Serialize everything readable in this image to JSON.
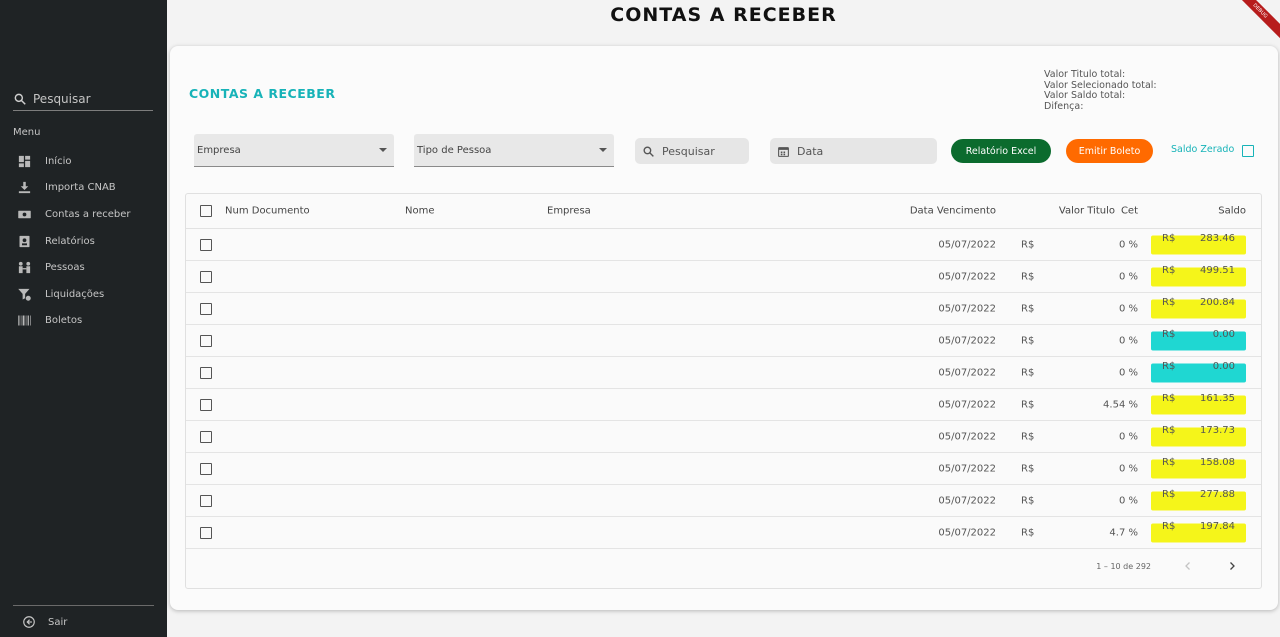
{
  "header": {
    "title": "CONTAS A RECEBER",
    "debug_label": "DEBUG"
  },
  "sidebar": {
    "search_placeholder": "Pesquisar",
    "menu_label": "Menu",
    "items": [
      {
        "label": "Início",
        "icon": "dashboard-icon"
      },
      {
        "label": "Importa CNAB",
        "icon": "download-icon"
      },
      {
        "label": "Contas a receber",
        "icon": "money-icon"
      },
      {
        "label": "Relatórios",
        "icon": "report-icon"
      },
      {
        "label": "Pessoas",
        "icon": "people-icon"
      },
      {
        "label": "Liquidações",
        "icon": "filter-money-icon"
      },
      {
        "label": "Boletos",
        "icon": "barcode-icon"
      }
    ],
    "logout_label": "Sair"
  },
  "card": {
    "title": "CONTAS A RECEBER",
    "totals": {
      "valor_titulo": "Valor Titulo total:",
      "valor_selecionado": "Valor Selecionado total:",
      "valor_saldo": "Valor Saldo total:",
      "diferenca": "Difença:"
    }
  },
  "filters": {
    "empresa": "Empresa",
    "tipo_pessoa": "Tipo de Pessoa",
    "search": "Pesquisar",
    "date": "Data",
    "excel_button": "Relatório Excel",
    "boleto_button": "Emitir Boleto",
    "saldo_zerado": "Saldo Zerado"
  },
  "table": {
    "columns": {
      "num_documento": "Num Documento",
      "nome": "Nome",
      "empresa": "Empresa",
      "data_vencimento": "Data Vencimento",
      "cet": "Cet",
      "valor_titulo": "Valor Titulo",
      "saldo": "Saldo"
    },
    "rows": [
      {
        "date": "05/07/2022",
        "cet": "0 %",
        "valor": "R$",
        "saldo_cur": "R$",
        "saldo": "283.46",
        "status": "yellow"
      },
      {
        "date": "05/07/2022",
        "cet": "0 %",
        "valor": "R$",
        "saldo_cur": "R$",
        "saldo": "499.51",
        "status": "yellow"
      },
      {
        "date": "05/07/2022",
        "cet": "0 %",
        "valor": "R$",
        "saldo_cur": "R$",
        "saldo": "200.84",
        "status": "yellow"
      },
      {
        "date": "05/07/2022",
        "cet": "0 %",
        "valor": "R$",
        "saldo_cur": "R$",
        "saldo": "0.00",
        "status": "cyan"
      },
      {
        "date": "05/07/2022",
        "cet": "0 %",
        "valor": "R$",
        "saldo_cur": "R$",
        "saldo": "0.00",
        "status": "cyan"
      },
      {
        "date": "05/07/2022",
        "cet": "4.54 %",
        "valor": "R$",
        "saldo_cur": "R$",
        "saldo": "161.35",
        "status": "yellow"
      },
      {
        "date": "05/07/2022",
        "cet": "0 %",
        "valor": "R$",
        "saldo_cur": "R$",
        "saldo": "173.73",
        "status": "yellow"
      },
      {
        "date": "05/07/2022",
        "cet": "0 %",
        "valor": "R$",
        "saldo_cur": "R$",
        "saldo": "158.08",
        "status": "yellow"
      },
      {
        "date": "05/07/2022",
        "cet": "0 %",
        "valor": "R$",
        "saldo_cur": "R$",
        "saldo": "277.88",
        "status": "yellow"
      },
      {
        "date": "05/07/2022",
        "cet": "4.7 %",
        "valor": "R$",
        "saldo_cur": "R$",
        "saldo": "197.84",
        "status": "yellow"
      }
    ],
    "pagination": "1 – 10 de 292"
  },
  "colors": {
    "accent": "#17b3b8",
    "excel": "#0b6b2e",
    "boleto": "#ff6a00",
    "sidebar": "#1f2325",
    "saldo_positive": "#f5f51a",
    "saldo_zero": "#1fd7d2"
  }
}
